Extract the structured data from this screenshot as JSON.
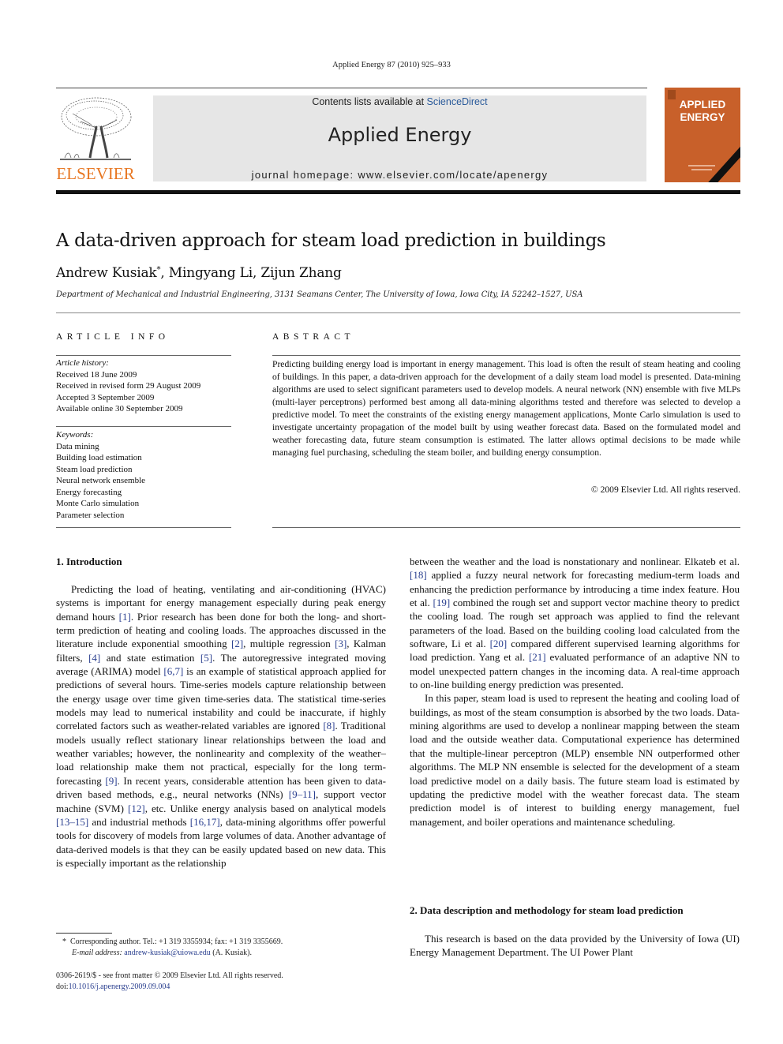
{
  "header": {
    "citation": "Applied Energy 87 (2010) 925–933",
    "contents_prefix": "Contents lists available at ",
    "sciencedirect_link": "ScienceDirect",
    "journal_title": "Applied Energy",
    "homepage": "journal homepage: www.elsevier.com/locate/apenergy",
    "publisher_logo_text": "ELSEVIER",
    "cover_title_line1": "APPLIED",
    "cover_title_line2": "ENERGY",
    "colors": {
      "publisher_orange": "#e87722",
      "cover_orange": "#c8602a",
      "banner_gray": "#e6e6e6",
      "link_blue": "#2a3f8f"
    }
  },
  "article": {
    "title": "A data-driven approach for steam load prediction in buildings",
    "authors": [
      {
        "name": "Andrew Kusiak",
        "mark": "*"
      },
      {
        "name": "Mingyang Li",
        "mark": ""
      },
      {
        "name": "Zijun Zhang",
        "mark": ""
      }
    ],
    "author_sep": ", ",
    "affiliation": "Department of Mechanical and Industrial Engineering, 3131 Seamans Center, The University of Iowa, Iowa City, IA 52242–1527, USA"
  },
  "article_info": {
    "heading": "ARTICLE INFO",
    "history_label": "Article history:",
    "history": [
      "Received 18 June 2009",
      "Received in revised form 29 August 2009",
      "Accepted 3 September 2009",
      "Available online 30 September 2009"
    ],
    "keywords_label": "Keywords:",
    "keywords": [
      "Data mining",
      "Building load estimation",
      "Steam load prediction",
      "Neural network ensemble",
      "Energy forecasting",
      "Monte Carlo simulation",
      "Parameter selection"
    ]
  },
  "abstract": {
    "heading": "ABSTRACT",
    "text": "Predicting building energy load is important in energy management. This load is often the result of steam heating and cooling of buildings. In this paper, a data-driven approach for the development of a daily steam load model is presented. Data-mining algorithms are used to select significant parameters used to develop models. A neural network (NN) ensemble with five MLPs (multi-layer perceptrons) performed best among all data-mining algorithms tested and therefore was selected to develop a predictive model. To meet the constraints of the existing energy management applications, Monte Carlo simulation is used to investigate uncertainty propagation of the model built by using weather forecast data. Based on the formulated model and weather forecasting data, future steam consumption is estimated. The latter allows optimal decisions to be made while managing fuel purchasing, scheduling the steam boiler, and building energy consumption.",
    "copyright": "© 2009 Elsevier Ltd. All rights reserved."
  },
  "body": {
    "section1_heading": "1. Introduction",
    "section1_paragraphs": [
      [
        {
          "t": "Predicting the load of heating, ventilating and air-conditioning (HVAC) systems is important for energy management especially during peak energy demand hours "
        },
        {
          "r": "[1]"
        },
        {
          "t": ". Prior research has been done for both the long- and short-term prediction of heating and cooling loads. The approaches discussed in the literature include exponential smoothing "
        },
        {
          "r": "[2]"
        },
        {
          "t": ", multiple regression "
        },
        {
          "r": "[3]"
        },
        {
          "t": ", Kalman filters, "
        },
        {
          "r": "[4]"
        },
        {
          "t": " and state estimation "
        },
        {
          "r": "[5]"
        },
        {
          "t": ". The autoregressive integrated moving average (ARIMA) model "
        },
        {
          "r": "[6,7]"
        },
        {
          "t": " is an example of statistical approach applied for predictions of several hours. Time-series models capture relationship between the energy usage over time given time-series data. The statistical time-series models may lead to numerical instability and could be inaccurate, if highly correlated factors such as weather-related variables are ignored "
        },
        {
          "r": "[8]"
        },
        {
          "t": ". Traditional models usually reflect stationary linear relationships between the load and weather variables; however, the nonlinearity and complexity of the weather–load relationship make them not practical, especially for the long term-forecasting "
        },
        {
          "r": "[9]"
        },
        {
          "t": ". In recent years, considerable attention has been given to data-driven based methods, e.g., neural networks (NNs) "
        },
        {
          "r": "[9–11]"
        },
        {
          "t": ", support vector machine (SVM) "
        },
        {
          "r": "[12]"
        },
        {
          "t": ", etc. Unlike energy analysis based on analytical models "
        },
        {
          "r": "[13–15]"
        },
        {
          "t": " and industrial methods "
        },
        {
          "r": "[16,17]"
        },
        {
          "t": ", data-mining algorithms offer powerful tools for discovery of models from large volumes of data. Another advantage of data-derived models is that they can be easily updated based on new data. This is especially important as the relationship"
        }
      ]
    ],
    "right_col_continuation": [
      {
        "t": "between the weather and the load is nonstationary and nonlinear. Elkateb et al. "
      },
      {
        "r": "[18]"
      },
      {
        "t": " applied a fuzzy neural network for forecasting medium-term loads and enhancing the prediction performance by introducing a time index feature. Hou et al. "
      },
      {
        "r": "[19]"
      },
      {
        "t": " combined the rough set and support vector machine theory to predict the cooling load. The rough set approach was applied to find the relevant parameters of the load. Based on the building cooling load calculated from the software, Li et al. "
      },
      {
        "r": "[20]"
      },
      {
        "t": " compared different supervised learning algorithms for load prediction. Yang et al. "
      },
      {
        "r": "[21]"
      },
      {
        "t": " evaluated performance of an adaptive NN to model unexpected pattern changes in the incoming data. A real-time approach to on-line building energy prediction was presented."
      }
    ],
    "right_col_paragraph2": "In this paper, steam load is used to represent the heating and cooling load of buildings, as most of the steam consumption is absorbed by the two loads. Data-mining algorithms are used to develop a nonlinear mapping between the steam load and the outside weather data. Computational experience has determined that the multiple-linear perceptron (MLP) ensemble NN outperformed other algorithms. The MLP NN ensemble is selected for the development of a steam load predictive model on a daily basis. The future steam load is estimated by updating the predictive model with the weather forecast data. The steam prediction model is of interest to building energy management, fuel management, and boiler operations and maintenance scheduling.",
    "section2_heading": "2. Data description and methodology for steam load prediction",
    "section2_paragraph": "This research is based on the data provided by the University of Iowa (UI) Energy Management Department. The UI Power Plant"
  },
  "footnotes": {
    "mark": "*",
    "corresponding": "Corresponding author. Tel.: +1 319 3355934; fax: +1 319 3355669.",
    "email_label": "E-mail address:",
    "email": "andrew-kusiak@uiowa.edu",
    "email_suffix": " (A. Kusiak).",
    "front_matter": "0306-2619/$ - see front matter © 2009 Elsevier Ltd. All rights reserved.",
    "doi_label": "doi:",
    "doi": "10.1016/j.apenergy.2009.09.004"
  }
}
